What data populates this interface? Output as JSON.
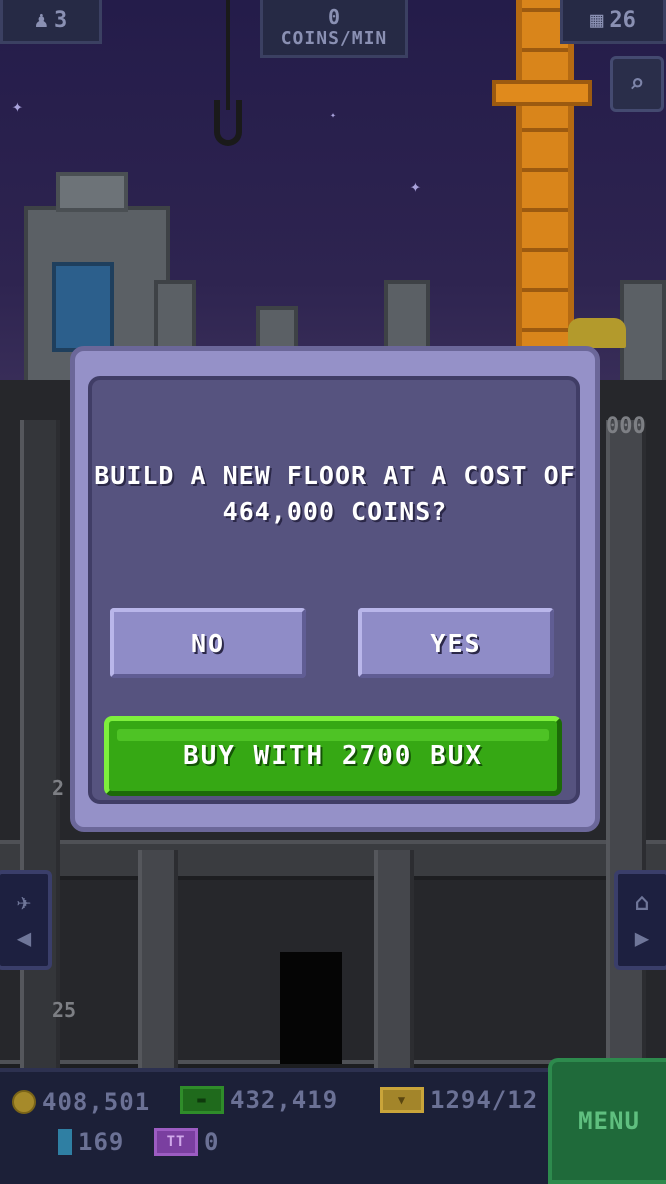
{
  "hud": {
    "bitizen_icon": "person-icon",
    "bitizens": "3",
    "coins_per_min_value": "0",
    "coins_per_min_label": "COINS/MIN",
    "floors_icon": "building-icon",
    "floors": "26",
    "search_icon": "magnifier-icon"
  },
  "tower": {
    "floor_labels": [
      "2",
      "25"
    ],
    "right_sign": "000",
    "left_nav_icons": [
      "person-icon",
      "arrow-left-icon"
    ],
    "right_nav_icons": [
      "home-icon",
      "arrow-right-icon"
    ]
  },
  "dialog": {
    "message": "BUILD A NEW FLOOR AT A COST OF 464,000 COINS?",
    "no_label": "NO",
    "yes_label": "YES",
    "buy_label": "BUY WITH 2700 BUX"
  },
  "bottom": {
    "coins": "408,501",
    "bux_rate": "432,419",
    "storage": "1294/12",
    "bitizens_total": "169",
    "tickets": "0",
    "menu_label": "MENU"
  },
  "colors": {
    "dialog_bg": "#56537f",
    "dialog_border": "#9591c8",
    "button_purple": "#8f8cc7",
    "buy_green": "#36a814",
    "menu_green": "#1f6a3a"
  }
}
